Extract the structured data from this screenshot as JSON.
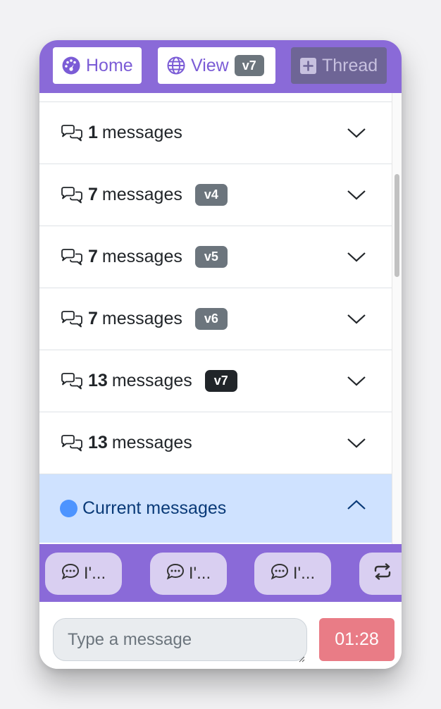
{
  "nav": {
    "home_label": "Home",
    "view_label": "View",
    "view_badge": "v7",
    "thread_label": "Thread"
  },
  "threads": [
    {
      "count": "1",
      "label": "messages",
      "badge": "",
      "expanded": false
    },
    {
      "count": "7",
      "label": "messages",
      "badge": "v4",
      "expanded": false
    },
    {
      "count": "7",
      "label": "messages",
      "badge": "v5",
      "expanded": false
    },
    {
      "count": "7",
      "label": "messages",
      "badge": "v6",
      "expanded": false
    },
    {
      "count": "13",
      "label": "messages",
      "badge": "v7",
      "badge_style": "dark",
      "expanded": false
    },
    {
      "count": "13",
      "label": "messages",
      "badge": "",
      "expanded": false
    }
  ],
  "current": {
    "label": "Current messages",
    "expanded": true
  },
  "suggestions": [
    {
      "label": "I'..."
    },
    {
      "label": "I'..."
    },
    {
      "label": "I'..."
    }
  ],
  "composer": {
    "placeholder": "Type a message",
    "value": "",
    "timer": "01:28"
  },
  "colors": {
    "accent": "#8a6ad8",
    "badge": "#6c757d",
    "badge_dark": "#212529",
    "current_bg": "#cfe2ff",
    "current_dot": "#4d94ff",
    "timer_bg": "#e97c86"
  },
  "icons": {
    "home": "speedometer-icon",
    "view": "globe-icon",
    "thread": "plus-square-icon",
    "row": "chat-bubbles-icon",
    "row_toggle": "chevron-down-icon",
    "current_toggle": "chevron-up-icon",
    "chip": "chat-dots-icon",
    "refresh": "arrow-repeat-icon"
  }
}
